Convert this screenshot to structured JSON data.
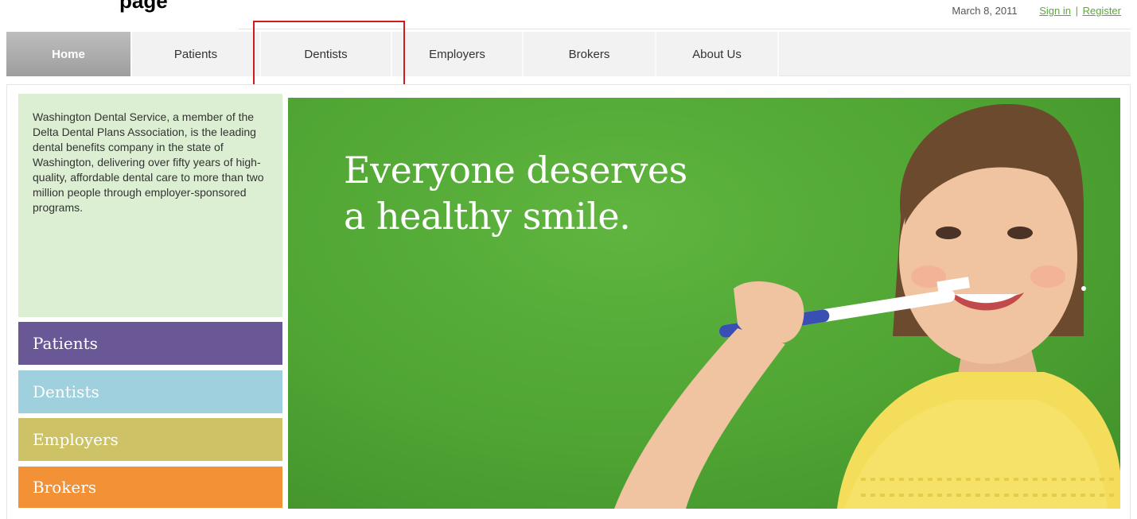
{
  "header": {
    "cropped_title": "page",
    "date": "March 8, 2011",
    "sign_in": "Sign in",
    "separator": "|",
    "register": "Register"
  },
  "nav": {
    "items": [
      {
        "label": "Home",
        "active": true
      },
      {
        "label": "Patients",
        "active": false
      },
      {
        "label": "Dentists",
        "active": false
      },
      {
        "label": "Employers",
        "active": false
      },
      {
        "label": "Brokers",
        "active": false
      },
      {
        "label": "About Us",
        "active": false
      }
    ]
  },
  "intro": {
    "text": "Washington Dental Service, a member of the Delta Dental Plans Association, is the leading dental benefits company in the state of Washington, delivering over fifty years of high-quality, affordable dental care to more than two million people through employer-sponsored programs."
  },
  "audience": {
    "patients": "Patients",
    "dentists": "Dentists",
    "employers": "Employers",
    "brokers": "Brokers"
  },
  "hero": {
    "line1": "Everyone deserves",
    "line2": "a healthy smile.",
    "image_subject": "girl-brushing-teeth"
  },
  "colors": {
    "accent_green": "#5aa83a",
    "hero_green": "#4fa433",
    "patients": "#6a5896",
    "dentists": "#9fd0de",
    "employers": "#cdc366",
    "brokers": "#f39137",
    "intro_bg": "#dcefd3",
    "highlight_red": "#d01c1c"
  }
}
